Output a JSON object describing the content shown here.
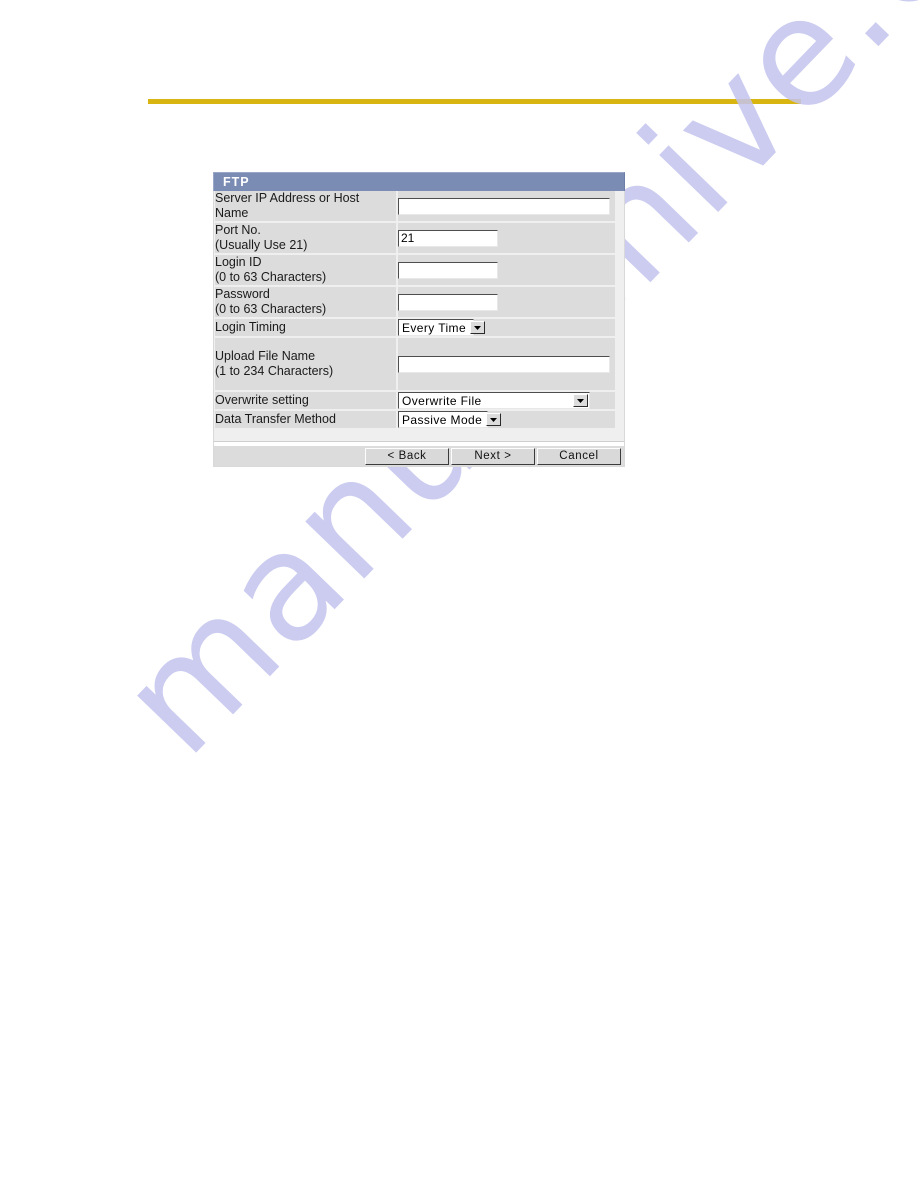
{
  "page": {
    "background_color": "#ffffff",
    "rule_color": "#d8b510"
  },
  "watermark": {
    "text": "manualshive.com",
    "color": "#c3c4ee"
  },
  "panel": {
    "title": "FTP",
    "title_bar_color": "#7b8cb4",
    "label_cell_color": "#dcdcdc",
    "rows": [
      {
        "name": "server-address",
        "label_lines": [
          "Server IP Address or Host",
          "Name"
        ],
        "control": "text",
        "value": "",
        "placeholder": ""
      },
      {
        "name": "port-no",
        "label_lines": [
          "Port No.",
          "(Usually Use 21)"
        ],
        "control": "text",
        "value": "21",
        "placeholder": ""
      },
      {
        "name": "login-id",
        "label_lines": [
          "Login ID",
          "(0 to 63 Characters)"
        ],
        "control": "text",
        "value": "",
        "placeholder": ""
      },
      {
        "name": "password",
        "label_lines": [
          "Password",
          "(0 to 63 Characters)"
        ],
        "control": "text",
        "value": "",
        "placeholder": ""
      },
      {
        "name": "login-timing",
        "label_lines": [
          "Login Timing"
        ],
        "control": "select",
        "value": "Every Time"
      },
      {
        "name": "upload-file-name",
        "label_lines": [
          "Upload File Name",
          "(1 to 234 Characters)"
        ],
        "control": "text",
        "value": "",
        "placeholder": ""
      },
      {
        "name": "overwrite-setting",
        "label_lines": [
          "Overwrite setting"
        ],
        "control": "select",
        "value": "Overwrite File"
      },
      {
        "name": "data-transfer-method",
        "label_lines": [
          "Data Transfer Method"
        ],
        "control": "select",
        "value": "Passive Mode"
      }
    ]
  },
  "footer": {
    "back_label": "< Back",
    "next_label": "Next >",
    "cancel_label": "Cancel"
  }
}
